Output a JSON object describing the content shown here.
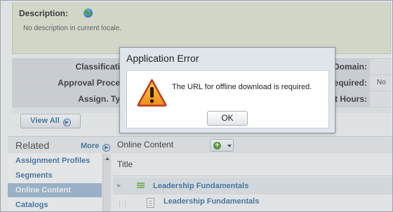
{
  "description": {
    "label": "Description:",
    "text": "No description in current locale."
  },
  "properties": {
    "rows": [
      {
        "label": "Classificati",
        "right_label": "Domain:",
        "right_value": ""
      },
      {
        "label": "Approval Proce",
        "right_label": "equired:",
        "right_value": "No"
      },
      {
        "label": "Assign. Ty",
        "right_label": "t Hours:",
        "right_value": ""
      }
    ],
    "view_all_label": "View All"
  },
  "related": {
    "title": "Related",
    "more_label": "More",
    "items": [
      {
        "label": "Assignment Profiles"
      },
      {
        "label": "Segments"
      },
      {
        "label": "Online Content"
      },
      {
        "label": "Catalogs"
      }
    ],
    "active_index": 2
  },
  "online_content": {
    "title": "Online Content",
    "add_symbol": "+",
    "column_title": "Title",
    "rows": [
      {
        "label": "Leadership Fundamentals"
      },
      {
        "label": "Leadership Fundamentals"
      }
    ]
  },
  "dialog": {
    "title": "Application Error",
    "message": "The URL for offline download is required.",
    "ok_label": "OK",
    "icon": "warning-icon"
  },
  "colors": {
    "accent": "#4d7eab",
    "warning_fill": "#f5a623",
    "warning_border": "#c0392b",
    "active_item": "#a7bfd7"
  }
}
